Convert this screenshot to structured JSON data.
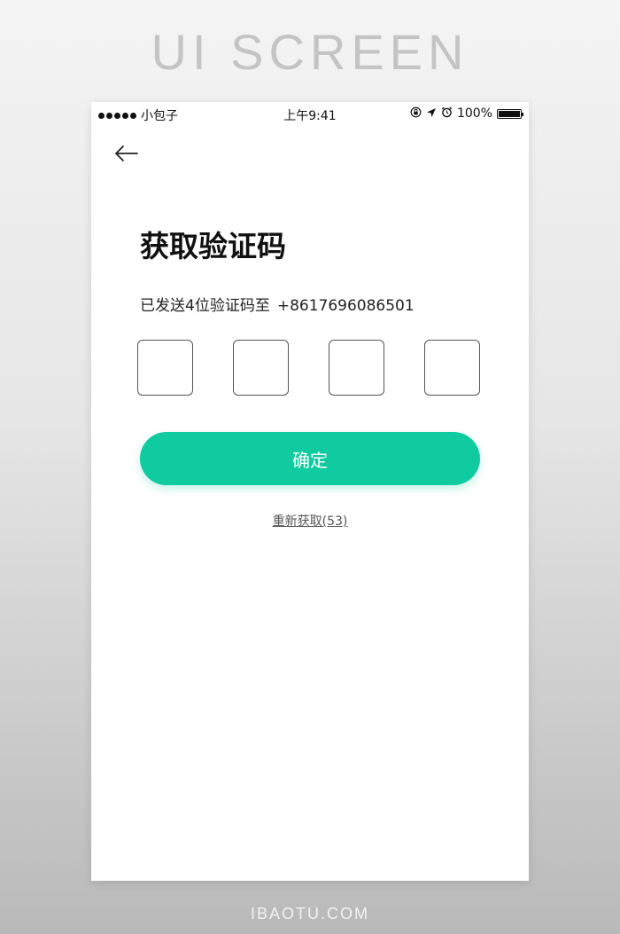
{
  "banner": {
    "title": "UI SCREEN"
  },
  "footer": {
    "brand": "IBAOTU.COM"
  },
  "status_bar": {
    "carrier": "小包子",
    "time": "上午9:41",
    "battery_percent": "100%",
    "icons": [
      "lock-rotation-icon",
      "location-arrow-icon",
      "alarm-icon",
      "battery-icon"
    ]
  },
  "nav": {
    "back_icon": "arrow-left-icon"
  },
  "page": {
    "title": "获取验证码",
    "sent_prefix": "已发送4位验证码至",
    "phone_number": "+8617696086501"
  },
  "code_inputs": {
    "count": 4,
    "values": [
      "",
      "",
      "",
      ""
    ]
  },
  "confirm_button": {
    "label": "确定"
  },
  "resend": {
    "label": "重新获取(53)"
  },
  "colors": {
    "accent": "#10cba0",
    "text": "#111111",
    "box_border": "#555555"
  }
}
